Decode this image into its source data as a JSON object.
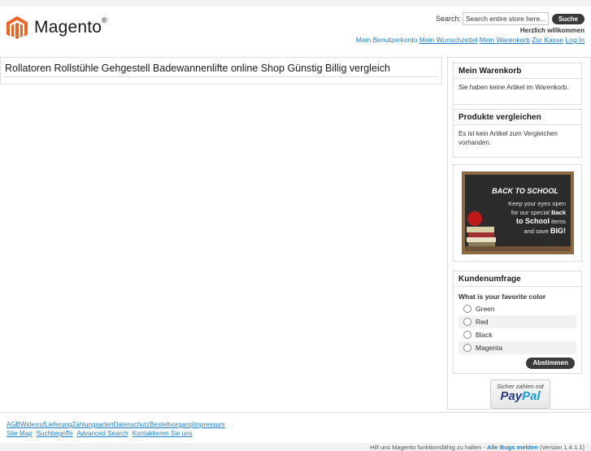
{
  "colors": {
    "link": "#1e7ec8",
    "logo_orange": "#f26322",
    "button_dark": "#3a3a3a"
  },
  "header": {
    "logo_text": "Magento",
    "logo_mark": "®",
    "search_label": "Search:",
    "search_placeholder": "Search entire store here...",
    "search_button": "Suche",
    "welcome": "Herzlich willkommen",
    "links": [
      "Mein Benutzerkonto",
      "Mein Wunschzettel",
      "Mein Warenkorb",
      "Zur Kasse",
      "Log In"
    ]
  },
  "main": {
    "title": "Rollatoren Rollstühle Gehgestell Badewannenlifte online Shop Günstig Billig vergleich"
  },
  "sidebar": {
    "cart": {
      "title": "Mein Warenkorb",
      "text": "Sie haben keine Artikel im Warenkorb."
    },
    "compare": {
      "title": "Produkte vergleichen",
      "text": "Es ist kein Artikel zum Vergleichen vorhanden."
    },
    "banner": {
      "heading": "BACK TO SCHOOL",
      "line1": "Keep your eyes open",
      "line2": "for our special",
      "line2b": "Back",
      "line3a": "to School",
      "line3b": "items",
      "line4a": "and save",
      "line4b": "BIG!"
    },
    "poll": {
      "title": "Kundenumfrage",
      "question": "What is your favorite color",
      "options": [
        "Green",
        "Red",
        "Black",
        "Magenta"
      ],
      "button": "Abstimmen"
    },
    "paypal": {
      "tagline": "Sicher zahlen mit",
      "logo_a": "Pay",
      "logo_b": "Pal"
    }
  },
  "footer": {
    "links_row1": "AGBWiderrufLieferungZahlungsartenDatenschutzBestellvorgangImpressum",
    "links_row2": [
      "Site Map",
      "Suchbegriffe",
      "Advanced Search",
      "Kontaktieren Sie uns"
    ],
    "note_prefix": "Hilf uns Magento funktionsfähig zu halten - ",
    "note_link": "Alle Bugs melden",
    "note_suffix": " (Version 1.4.1.1)"
  }
}
